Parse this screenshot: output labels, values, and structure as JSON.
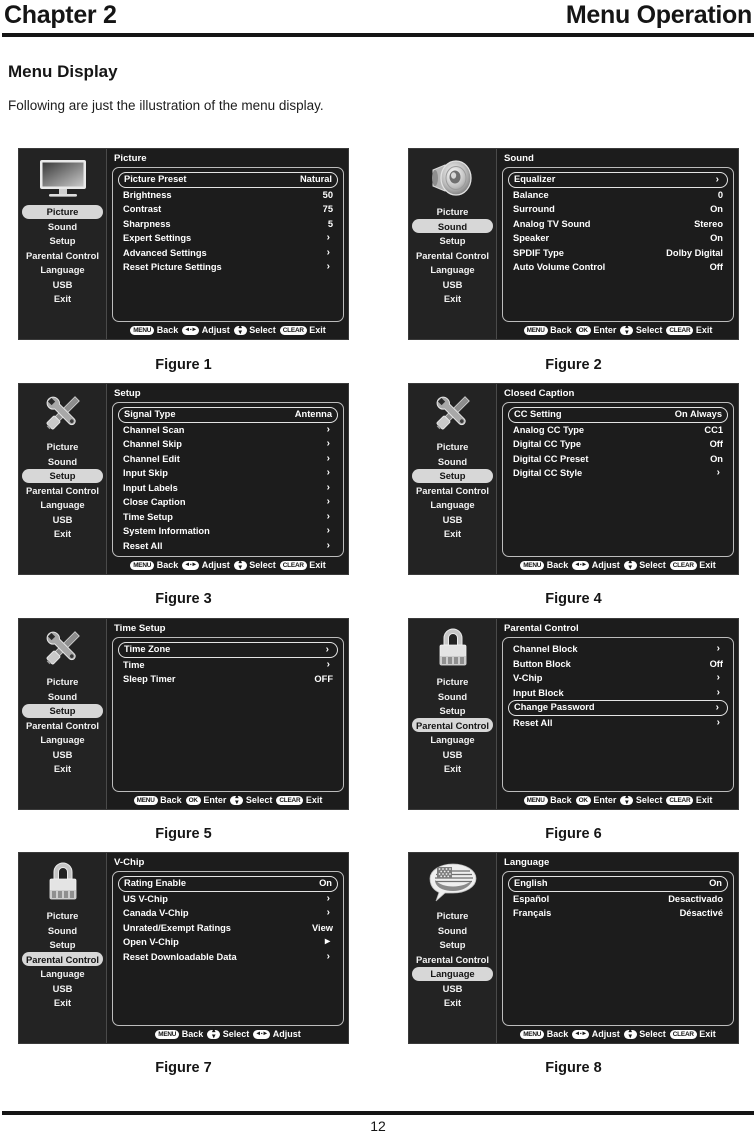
{
  "header": {
    "chapter": "Chapter 2",
    "section": "Menu Operation"
  },
  "section_title": "Menu Display",
  "intro": "Following are just the illustration of the menu display.",
  "footer": {
    "page_number": "12"
  },
  "hint_labels": {
    "menu": "MENU",
    "clear": "CLEAR",
    "ok": "OK",
    "back": "Back",
    "adjust": "Adjust",
    "select": "Select",
    "enter": "Enter",
    "exit": "Exit"
  },
  "nav_items": [
    "Picture",
    "Sound",
    "Setup",
    "Parental Control",
    "Language",
    "USB",
    "Exit"
  ],
  "figures": [
    {
      "caption": "Figure 1",
      "icon": "tv-icon",
      "selected_nav": "Picture",
      "title": "Picture",
      "rows": [
        {
          "label": "Picture Preset",
          "value": "Natural",
          "highlighted": true
        },
        {
          "label": "Brightness",
          "value": "50",
          "highlighted": false
        },
        {
          "label": "Contrast",
          "value": "75",
          "highlighted": false
        },
        {
          "label": "Sharpness",
          "value": "5",
          "highlighted": false
        },
        {
          "label": "Expert Settings",
          "value": "›",
          "arrow": true,
          "highlighted": false
        },
        {
          "label": "Advanced Settings",
          "value": "›",
          "arrow": true,
          "highlighted": false
        },
        {
          "label": "Reset Picture Settings",
          "value": "›",
          "arrow": true,
          "highlighted": false
        }
      ],
      "hints": [
        "MENU Back",
        "LR Adjust",
        "UD Select",
        "CLEAR Exit"
      ]
    },
    {
      "caption": "Figure 2",
      "icon": "speaker-icon",
      "selected_nav": "Sound",
      "title": "Sound",
      "rows": [
        {
          "label": "Equalizer",
          "value": "›",
          "arrow": true,
          "highlighted": true
        },
        {
          "label": "Balance",
          "value": "0",
          "highlighted": false
        },
        {
          "label": "Surround",
          "value": "On",
          "highlighted": false
        },
        {
          "label": "Analog TV Sound",
          "value": "Stereo",
          "highlighted": false
        },
        {
          "label": "Speaker",
          "value": "On",
          "highlighted": false
        },
        {
          "label": "SPDIF Type",
          "value": "Dolby Digital",
          "highlighted": false
        },
        {
          "label": "Auto Volume Control",
          "value": "Off",
          "highlighted": false
        }
      ],
      "hints": [
        "MENU Back",
        "OK Enter",
        "UD Select",
        "CLEAR Exit"
      ]
    },
    {
      "caption": "Figure 3",
      "icon": "tools-icon",
      "selected_nav": "Setup",
      "title": "Setup",
      "rows": [
        {
          "label": "Signal Type",
          "value": "Antenna",
          "highlighted": true
        },
        {
          "label": "Channel Scan",
          "value": "›",
          "arrow": true,
          "highlighted": false
        },
        {
          "label": "Channel Skip",
          "value": "›",
          "arrow": true,
          "highlighted": false
        },
        {
          "label": "Channel Edit",
          "value": "›",
          "arrow": true,
          "highlighted": false
        },
        {
          "label": "Input Skip",
          "value": "›",
          "arrow": true,
          "highlighted": false
        },
        {
          "label": "Input Labels",
          "value": "›",
          "arrow": true,
          "highlighted": false
        },
        {
          "label": "Close Caption",
          "value": "›",
          "arrow": true,
          "highlighted": false
        },
        {
          "label": "Time Setup",
          "value": "›",
          "arrow": true,
          "highlighted": false
        },
        {
          "label": "System Information",
          "value": "›",
          "arrow": true,
          "highlighted": false
        },
        {
          "label": "Reset All",
          "value": "›",
          "arrow": true,
          "highlighted": false
        }
      ],
      "hints": [
        "MENU Back",
        "LR Adjust",
        "UD Select",
        "CLEAR Exit"
      ]
    },
    {
      "caption": "Figure 4",
      "icon": "tools-icon",
      "selected_nav": "Setup",
      "title": "Closed Caption",
      "rows": [
        {
          "label": "CC Setting",
          "value": "On Always",
          "highlighted": true
        },
        {
          "label": "Analog CC Type",
          "value": "CC1",
          "highlighted": false
        },
        {
          "label": "Digital CC Type",
          "value": "Off",
          "highlighted": false
        },
        {
          "label": "Digital CC Preset",
          "value": "On",
          "highlighted": false
        },
        {
          "label": "Digital CC Style",
          "value": "›",
          "arrow": true,
          "highlighted": false
        }
      ],
      "hints": [
        "MENU Back",
        "LR Adjust",
        "UD Select",
        "CLEAR Exit"
      ]
    },
    {
      "caption": "Figure 5",
      "icon": "tools-icon",
      "selected_nav": "Setup",
      "title": "Time Setup",
      "rows": [
        {
          "label": "Time Zone",
          "value": "›",
          "arrow": true,
          "highlighted": true
        },
        {
          "label": "Time",
          "value": "›",
          "arrow": true,
          "highlighted": false
        },
        {
          "label": "Sleep Timer",
          "value": "OFF",
          "highlighted": false
        }
      ],
      "hints": [
        "MENU Back",
        "OK Enter",
        "UD Select",
        "CLEAR Exit"
      ]
    },
    {
      "caption": "Figure 6",
      "icon": "lock-icon",
      "selected_nav": "Parental Control",
      "title": "Parental Control",
      "rows": [
        {
          "label": "Channel Block",
          "value": "›",
          "arrow": true,
          "highlighted": false
        },
        {
          "label": "Button Block",
          "value": "Off",
          "highlighted": false
        },
        {
          "label": "V-Chip",
          "value": "›",
          "arrow": true,
          "highlighted": false
        },
        {
          "label": "Input Block",
          "value": "›",
          "arrow": true,
          "highlighted": false
        },
        {
          "label": "Change Password",
          "value": "›",
          "arrow": true,
          "highlighted": true
        },
        {
          "label": "Reset All",
          "value": "›",
          "arrow": true,
          "highlighted": false
        }
      ],
      "hints": [
        "MENU Back",
        "OK Enter",
        "UD Select",
        "CLEAR Exit"
      ]
    },
    {
      "caption": "Figure 7",
      "icon": "lock-icon",
      "selected_nav": "Parental Control",
      "title": "V-Chip",
      "rows": [
        {
          "label": "Rating Enable",
          "value": "On",
          "highlighted": true
        },
        {
          "label": "US V-Chip",
          "value": "›",
          "arrow": true,
          "highlighted": false
        },
        {
          "label": "Canada V-Chip",
          "value": "›",
          "arrow": true,
          "highlighted": false
        },
        {
          "label": "Unrated/Exempt Ratings",
          "value": "View",
          "highlighted": false
        },
        {
          "label": "Open V-Chip",
          "value": "▸",
          "arrow": true,
          "highlighted": false
        },
        {
          "label": "Reset Downloadable Data",
          "value": "›",
          "arrow": true,
          "highlighted": false
        }
      ],
      "hints": [
        "MENU Back",
        "UD Select",
        "LR Adjust"
      ]
    },
    {
      "caption": "Figure 8",
      "icon": "language-icon",
      "selected_nav": "Language",
      "title": "Language",
      "rows": [
        {
          "label": "English",
          "value": "On",
          "highlighted": true
        },
        {
          "label": "Español",
          "value": "Desactivado",
          "highlighted": false
        },
        {
          "label": "Français",
          "value": "Désactivé",
          "highlighted": false
        }
      ],
      "hints": [
        "MENU Back",
        "LR Adjust",
        "UD Select",
        "CLEAR Exit"
      ]
    }
  ]
}
